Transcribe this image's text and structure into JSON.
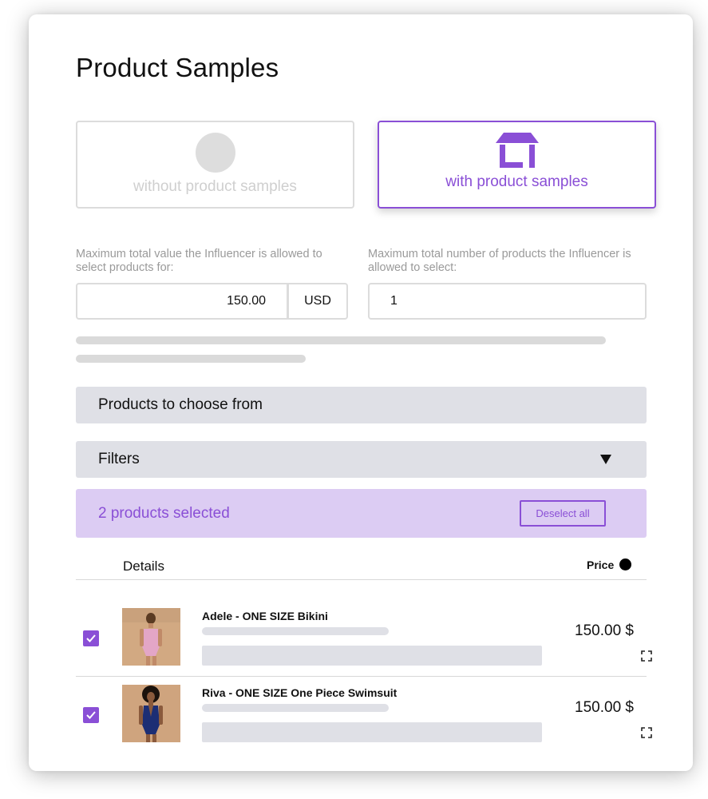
{
  "page": {
    "title": "Product Samples"
  },
  "options": {
    "without": {
      "label": "without product samples"
    },
    "with": {
      "label": "with product samples"
    }
  },
  "fields": {
    "max_value": {
      "label": "Maximum total value the Influencer is allowed to select products for:",
      "value": "150.00",
      "currency": "USD"
    },
    "max_count": {
      "label": "Maximum total number of products the Influencer is allowed to select:",
      "value": "1"
    }
  },
  "sections": {
    "products_header": "Products to choose from",
    "filters": "Filters"
  },
  "selection": {
    "summary": "2 products selected",
    "deselect_label": "Deselect all"
  },
  "table": {
    "details_header": "Details",
    "price_header": "Price",
    "rows": [
      {
        "name": "Adele - ONE SIZE Bikini",
        "price": "150.00 $",
        "checked": true,
        "icon": "check-icon"
      },
      {
        "name": "Riva - ONE SIZE One Piece Swimsuit",
        "price": "150.00 $",
        "checked": true,
        "icon": "check-icon"
      }
    ]
  },
  "colors": {
    "accent": "#8a4fd6",
    "selection_bg": "#dcccf3",
    "bar_bg": "#dfe0e6"
  }
}
